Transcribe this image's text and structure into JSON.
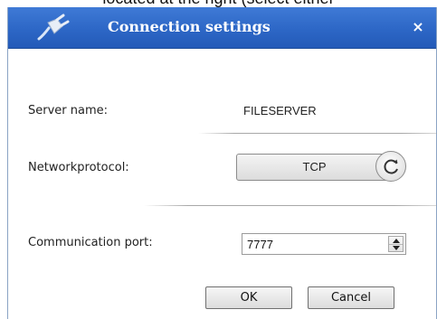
{
  "background": {
    "partial_text": "located at the right (select either"
  },
  "dialog": {
    "title": "Connection settings",
    "close_glyph": "×",
    "server_name_label": "Server name:",
    "server_name_value": "FILESERVER",
    "network_protocol_label": "Networkprotocol:",
    "network_protocol_value": "TCP",
    "communication_port_label": "Communication port:",
    "communication_port_value": "7777",
    "ok_label": "OK",
    "cancel_label": "Cancel"
  },
  "icons": {
    "title": "plug-icon",
    "close": "close-icon",
    "cycle": "cycle-icon",
    "spin_up": "spin-up-icon",
    "spin_down": "spin-down-icon"
  },
  "colors": {
    "titlebar": "#2d67c6",
    "title_text": "#ffffff",
    "separator": "#a8a8a8"
  }
}
